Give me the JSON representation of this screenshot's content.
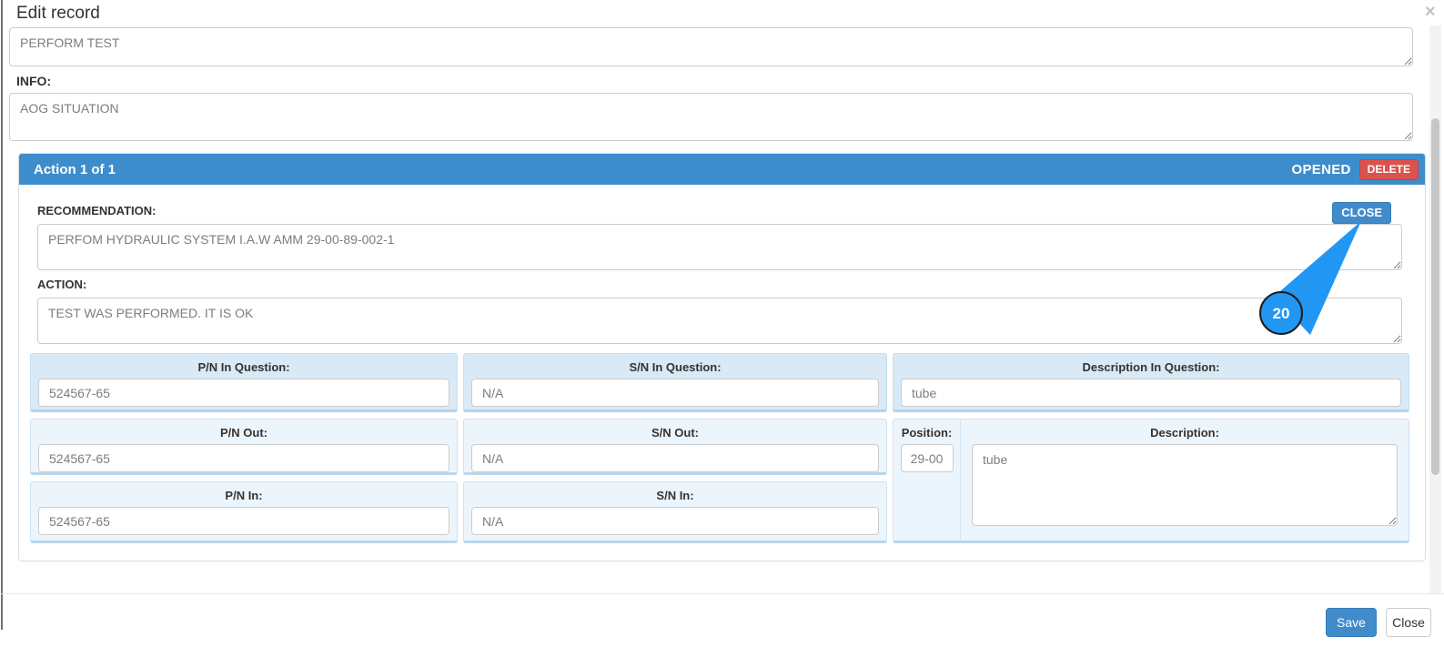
{
  "modal": {
    "title": "Edit record",
    "close_glyph": "×"
  },
  "fields": {
    "top_textarea_value": "PERFORM TEST",
    "info_label": "INFO:",
    "info_value": "AOG SITUATION"
  },
  "action_panel": {
    "header": "Action 1 of 1",
    "status": "OPENED",
    "delete_label": "DELETE",
    "close_label": "CLOSE",
    "recommendation_label": "RECOMMENDATION:",
    "recommendation_value": "PERFOM HYDRAULIC SYSTEM I.A.W AMM 29-00-89-002-1",
    "action_label": "ACTION:",
    "action_value": "TEST WAS PERFORMED. IT IS OK",
    "table": {
      "pn_in_question_label": "P/N In Question:",
      "pn_in_question_value": "524567-65",
      "sn_in_question_label": "S/N In Question:",
      "sn_in_question_value": "N/A",
      "desc_in_question_label": "Description In Question:",
      "desc_in_question_value": "tube",
      "pn_out_label": "P/N Out:",
      "pn_out_value": "524567-65",
      "sn_out_label": "S/N Out:",
      "sn_out_value": "N/A",
      "position_label": "Position:",
      "position_value": "29-00",
      "description_label": "Description:",
      "description_value": "tube",
      "pn_in_label": "P/N In:",
      "pn_in_value": "524567-65",
      "sn_in_label": "S/N In:",
      "sn_in_value": "N/A"
    }
  },
  "annotation": {
    "step_number": "20"
  },
  "footer": {
    "save_label": "Save",
    "close_label": "Close"
  },
  "colors": {
    "panel_header_blue": "#3d8dcc",
    "danger_red": "#d9534f",
    "button_blue": "#428bca",
    "annotation_blue": "#2196f3",
    "row1_cell_bg": "#d9eaf6",
    "row23_cell_bg": "#edf5fc"
  }
}
